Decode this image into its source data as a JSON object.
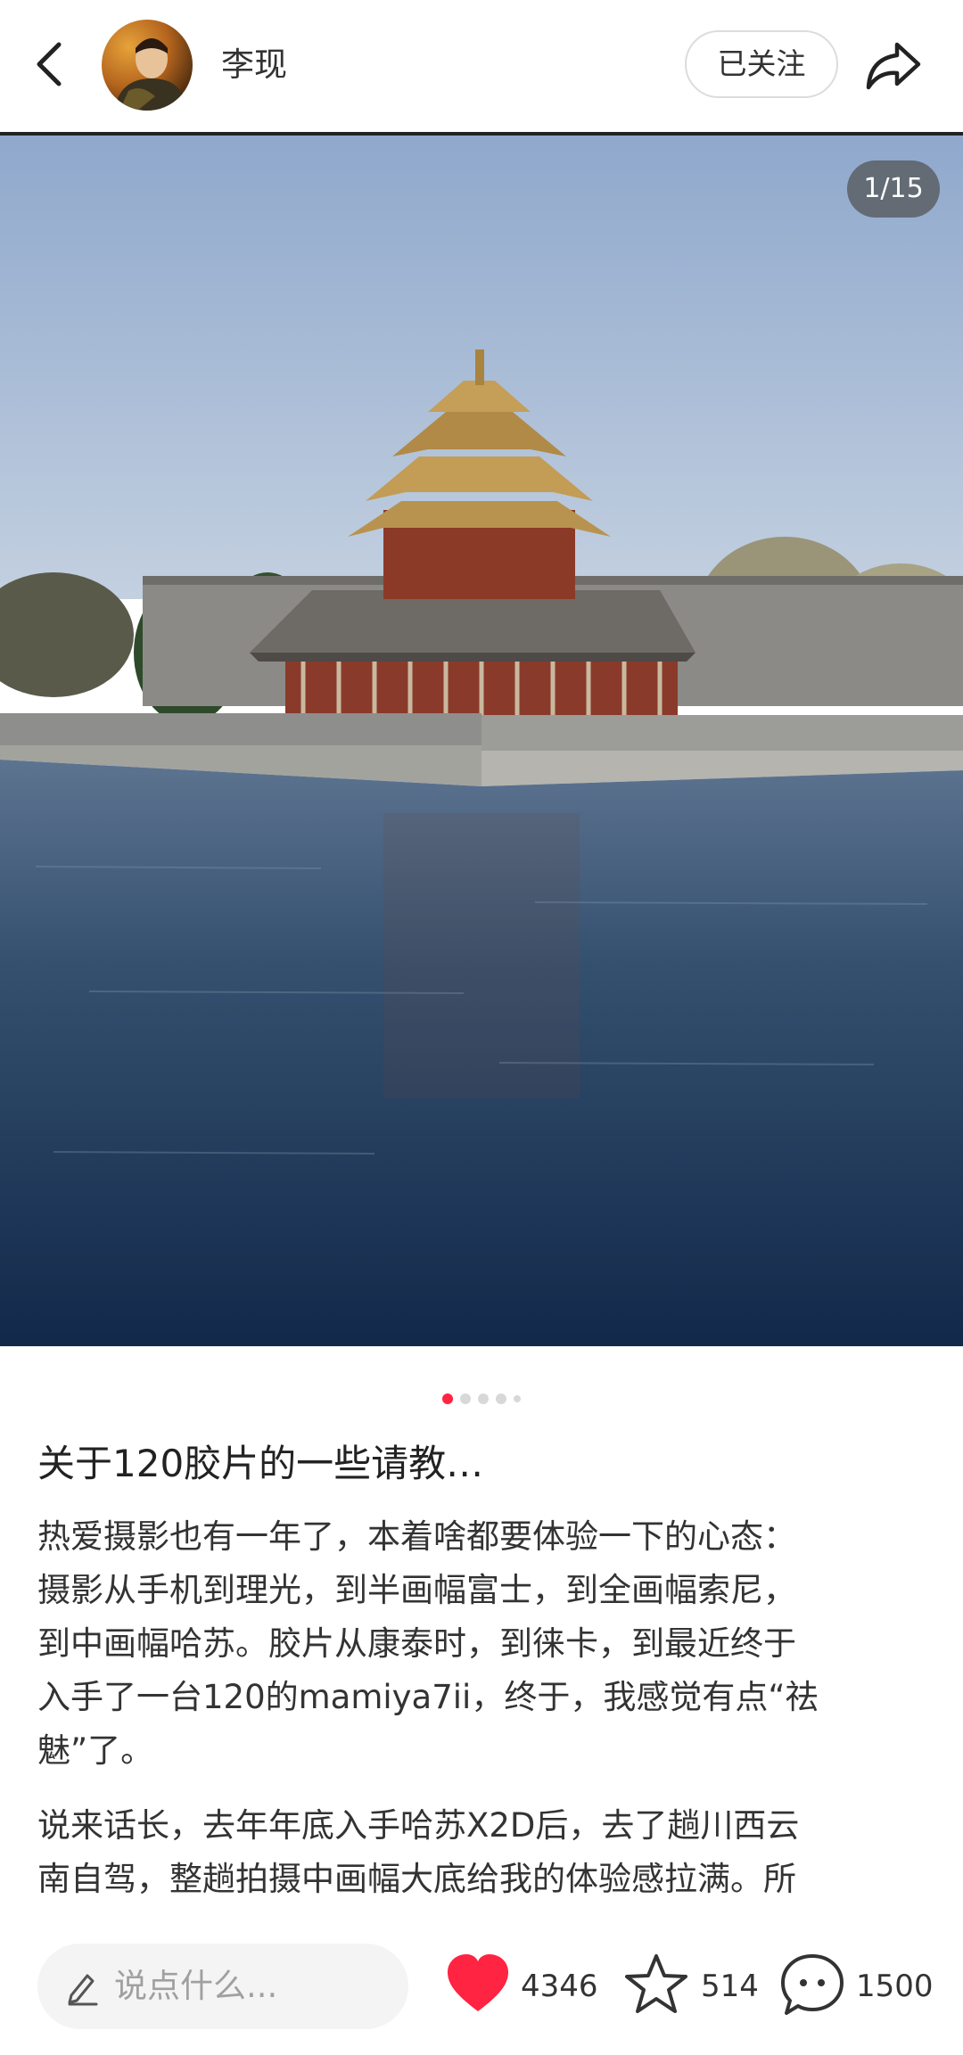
{
  "header": {
    "author_name": "李现",
    "follow_label": "已关注"
  },
  "gallery": {
    "counter": "1/15",
    "dot_count": 5,
    "active_dot": 0
  },
  "post": {
    "title": "关于120胶片的一些请教…",
    "paragraph1": "热爱摄影也有一年了，本着啥都要体验一下的心态：\n摄影从手机到理光，到半画幅富士，到全画幅索尼，\n到中画幅哈苏。胶片从康泰时，到徕卡，到最近终于\n入手了一台120的mamiya7ii，终于，我感觉有点“祛\n魅”了。",
    "paragraph2": "说来话长，去年年底入手哈苏X2D后，去了趟川西云\n南自驾，整趟拍摄中画幅大底给我的体验感拉满。所"
  },
  "bottom_bar": {
    "comment_placeholder": "说点什么...",
    "likes": "4346",
    "collects": "514",
    "comments": "1500",
    "like_color": "#ff2442"
  },
  "icons": [
    "back-icon",
    "share-icon",
    "pen-icon",
    "heart-icon",
    "star-icon",
    "comment-bubble-icon"
  ]
}
